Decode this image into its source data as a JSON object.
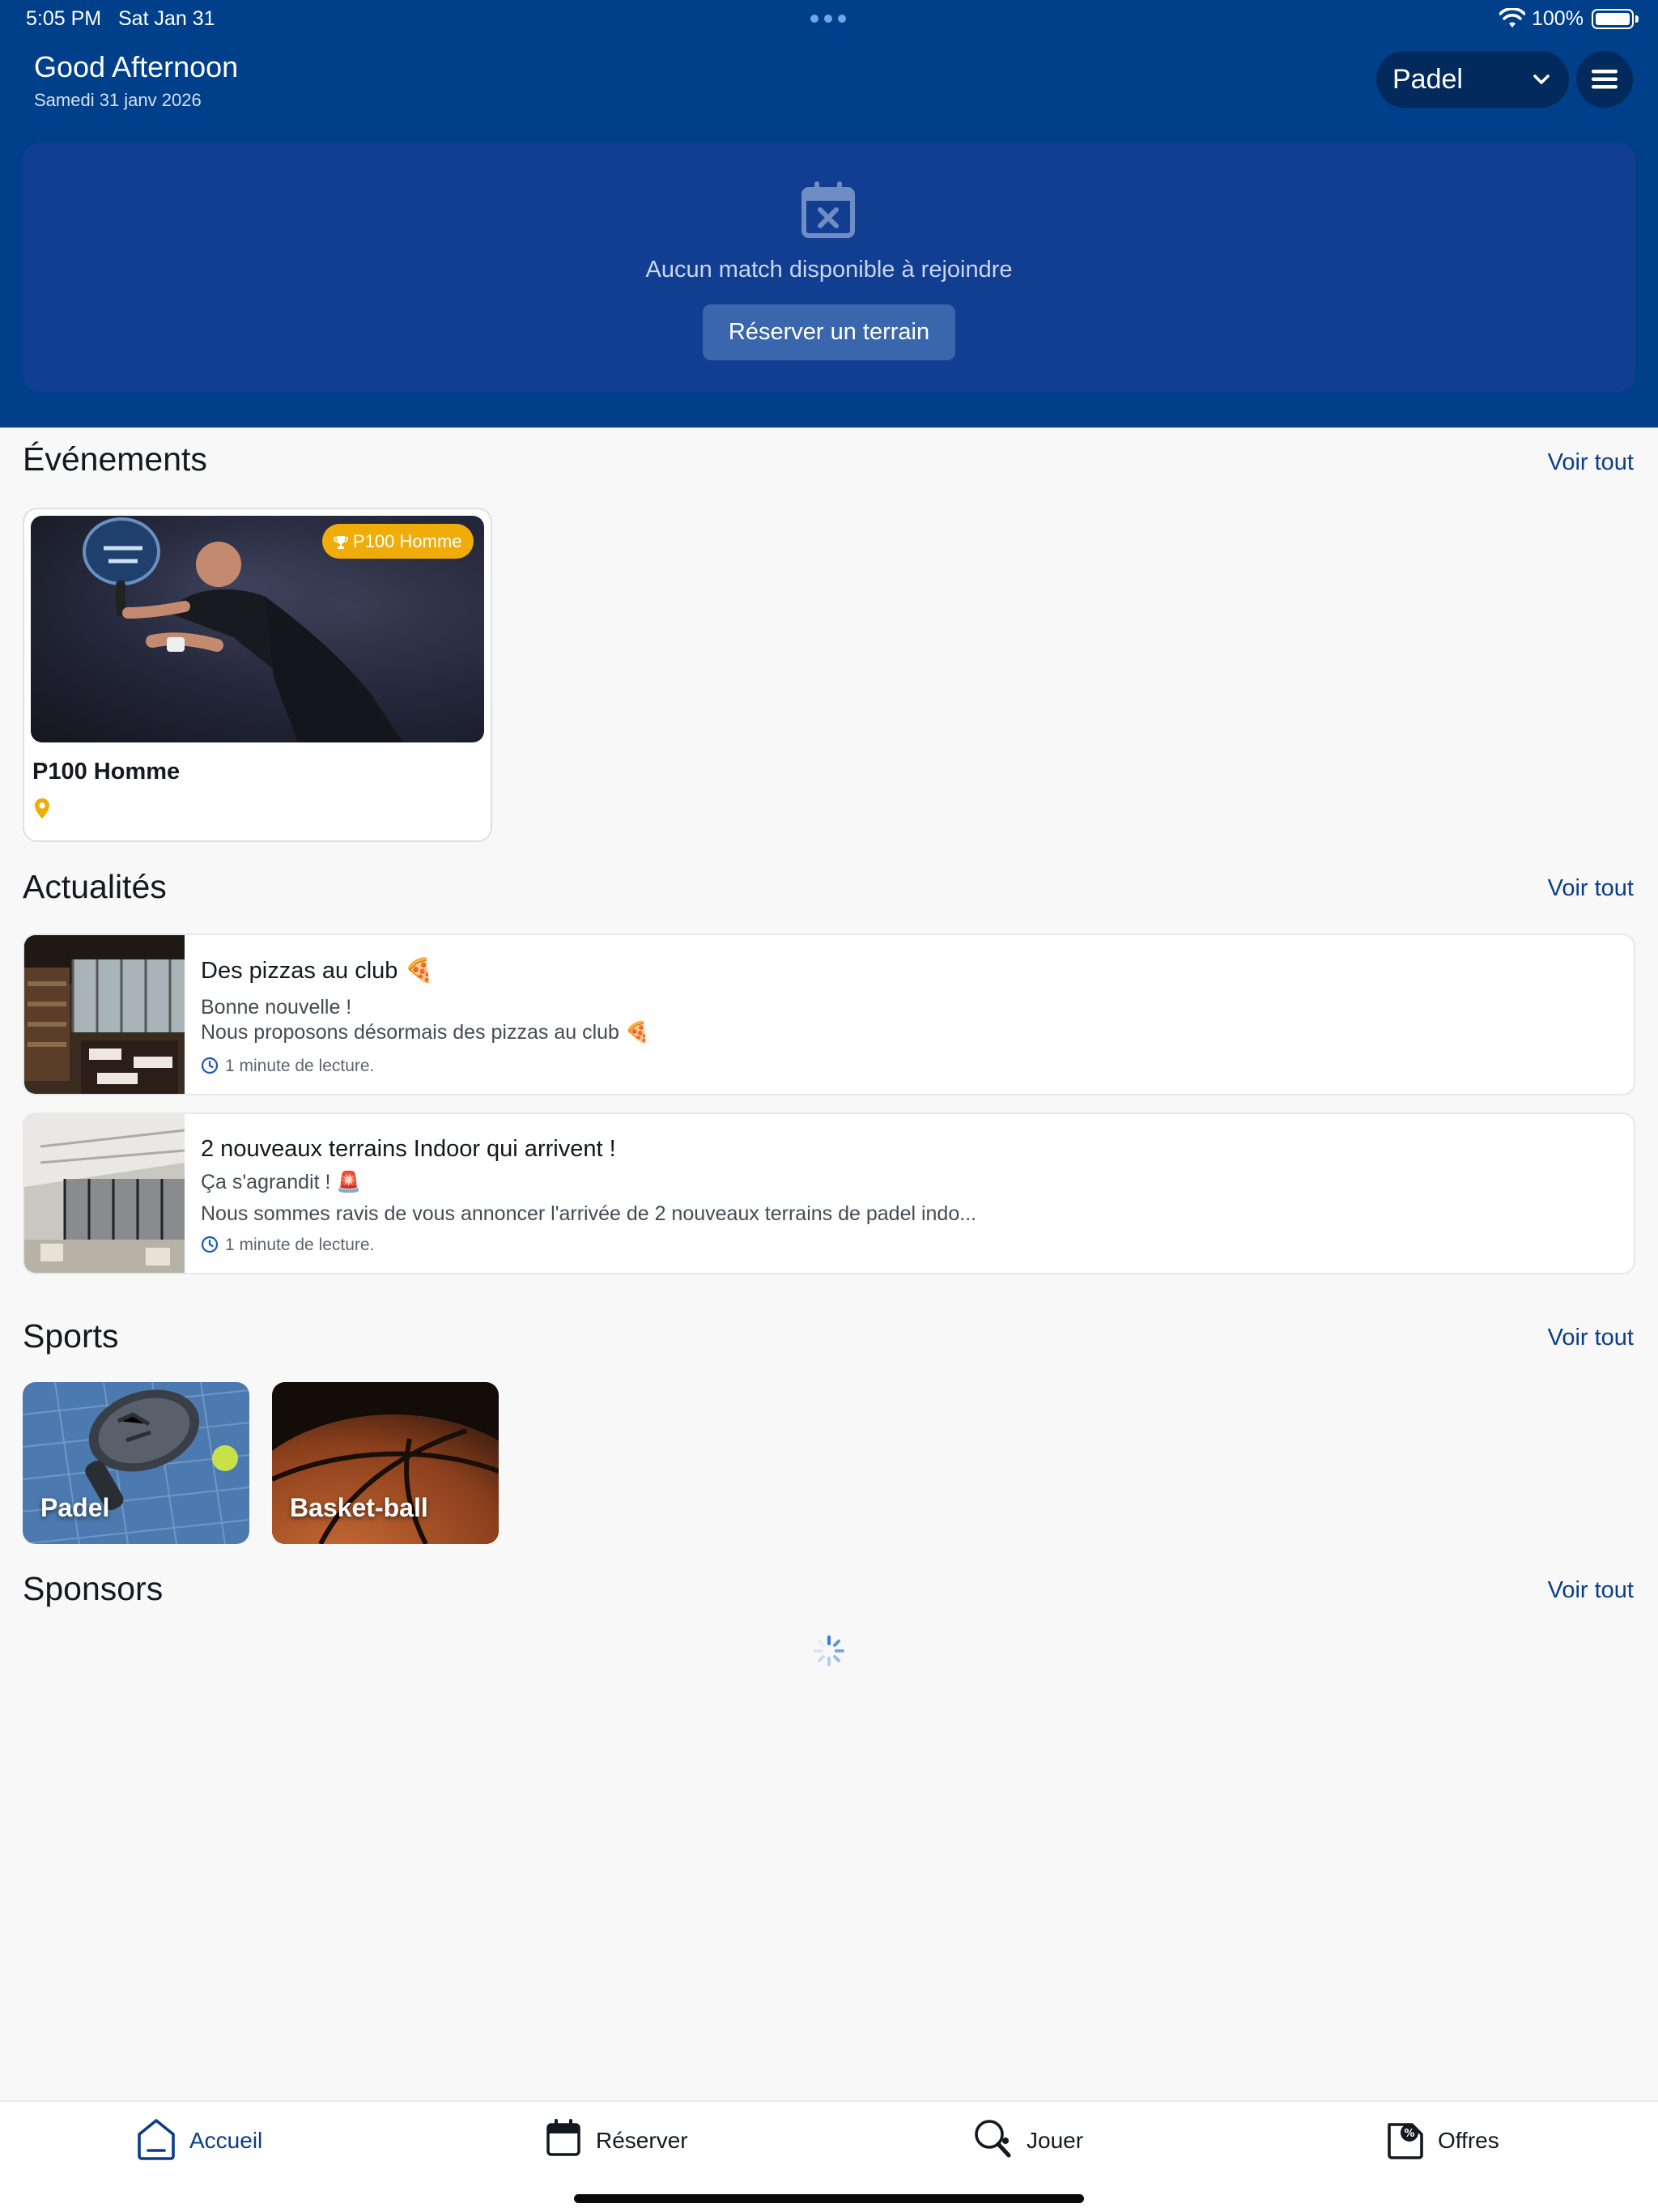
{
  "status_bar": {
    "time": "5:05 PM",
    "date": "Sat Jan 31",
    "battery": "100%"
  },
  "header": {
    "greeting": "Good Afternoon",
    "date": "Samedi 31 janv 2026",
    "sport_select": "Padel",
    "menu_icon": "hamburger-menu-icon"
  },
  "match_card": {
    "icon": "calendar-x-icon",
    "message": "Aucun match disponible à rejoindre",
    "button_label": "Réserver un terrain"
  },
  "events": {
    "title": "Événements",
    "see_all": "Voir tout",
    "items": [
      {
        "badge": "P100 Homme",
        "title": "P100 Homme",
        "icon": "location-pin-icon"
      }
    ]
  },
  "news": {
    "title": "Actualités",
    "see_all": "Voir tout",
    "items": [
      {
        "title": "Des pizzas au club 🍕",
        "lines": [
          "Bonne nouvelle !",
          "Nous proposons désormais des pizzas au club 🍕"
        ],
        "read_time": "1 minute de lecture."
      },
      {
        "title": "2 nouveaux terrains Indoor qui arrivent !",
        "lines": [
          "Ça s'agrandit ! 🚨",
          "Nous sommes ravis de vous annoncer l'arrivée de 2 nouveaux terrains de padel indo..."
        ],
        "read_time": "1 minute de lecture."
      }
    ]
  },
  "sports": {
    "title": "Sports",
    "see_all": "Voir tout",
    "items": [
      {
        "label": "Padel"
      },
      {
        "label": "Basket-ball"
      }
    ]
  },
  "sponsors": {
    "title": "Sponsors",
    "see_all": "Voir tout"
  },
  "tabbar": {
    "items": [
      {
        "label": "Accueil",
        "icon": "home-icon",
        "active": true
      },
      {
        "label": "Réserver",
        "icon": "calendar-icon",
        "active": false
      },
      {
        "label": "Jouer",
        "icon": "padel-racket-icon",
        "active": false
      },
      {
        "label": "Offres",
        "icon": "discount-tag-icon",
        "active": false
      }
    ]
  },
  "colors": {
    "header_bg": "#003f8a",
    "card_bg": "#123e92",
    "accent": "#0b3d86",
    "badge": "#f0ad0a"
  }
}
